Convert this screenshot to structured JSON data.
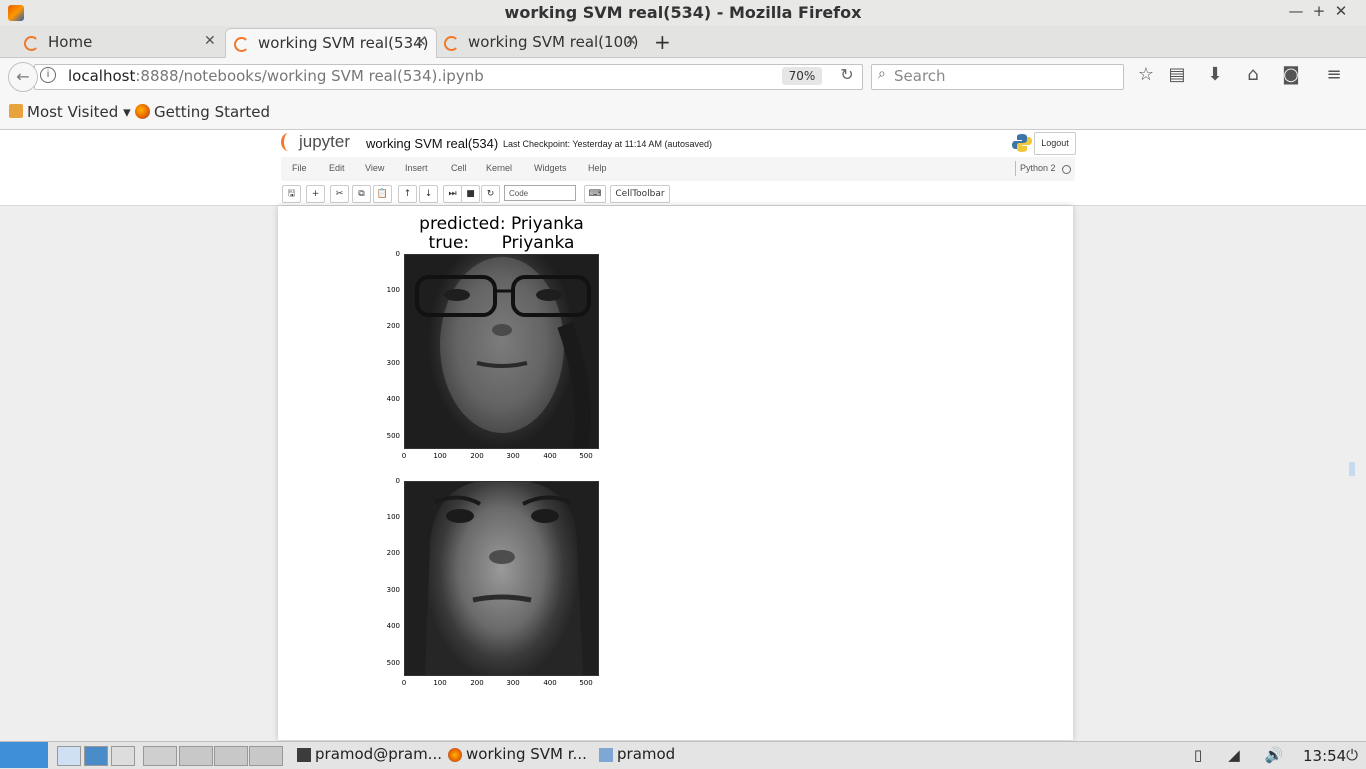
{
  "window": {
    "title": "working SVM real(534) - Mozilla Firefox",
    "min": "—",
    "max": "+",
    "close": "✕"
  },
  "tabs": [
    {
      "label": "Home",
      "close": "✕"
    },
    {
      "label": "working SVM real(534)",
      "close": "✕"
    },
    {
      "label": "working SVM real(100)",
      "close": "✕"
    }
  ],
  "newtab": "+",
  "nav": {
    "back": "←",
    "info": "i",
    "url_host": "localhost",
    "url_rest": ":8888/notebooks/working SVM real(534).ipynb",
    "zoom": "70%",
    "reload": "↻",
    "search_placeholder": "Search",
    "icons": [
      "star-icon",
      "reading-list-icon",
      "download-icon",
      "home-icon",
      "pocket-icon",
      "menu-icon"
    ],
    "icon_glyphs": [
      "☆",
      "▤",
      "⬇",
      "⌂",
      "◙",
      "≡"
    ]
  },
  "bookmarks": {
    "most_visited": "Most Visited ▾",
    "getting_started": "Getting Started"
  },
  "jupyter": {
    "logo_text": "jupyter",
    "notebook_name": "working SVM real(534)",
    "checkpoint": "Last Checkpoint: Yesterday at 11:14 AM (autosaved)",
    "logout": "Logout",
    "menu": [
      "File",
      "Edit",
      "View",
      "Insert",
      "Cell",
      "Kernel",
      "Widgets",
      "Help"
    ],
    "kernel": "Python 2",
    "cell_type": "Code",
    "celltoolbar": "CellToolbar",
    "toolbar_icons": [
      "save-icon",
      "add-cell-icon",
      "cut-icon",
      "copy-icon",
      "paste-icon",
      "move-up-icon",
      "move-down-icon",
      "run-icon",
      "stop-icon",
      "restart-icon"
    ],
    "toolbar_glyphs": [
      "🖫",
      "+",
      "✂",
      "⧉",
      "📋",
      "↑",
      "↓",
      "⏭",
      "■",
      "↻"
    ],
    "keyboard_glyph": "⌨"
  },
  "output": {
    "plot1": {
      "predicted": "predicted: Priyanka",
      "true": "true:      Priyanka"
    },
    "yticks": [
      "0",
      "100",
      "200",
      "300",
      "400",
      "500"
    ],
    "xticks": [
      "0",
      "100",
      "200",
      "300",
      "400",
      "500"
    ]
  },
  "taskbar": {
    "tasks": [
      "pramod@pram...",
      "working SVM r...",
      "pramod"
    ],
    "clock": "13:54"
  }
}
